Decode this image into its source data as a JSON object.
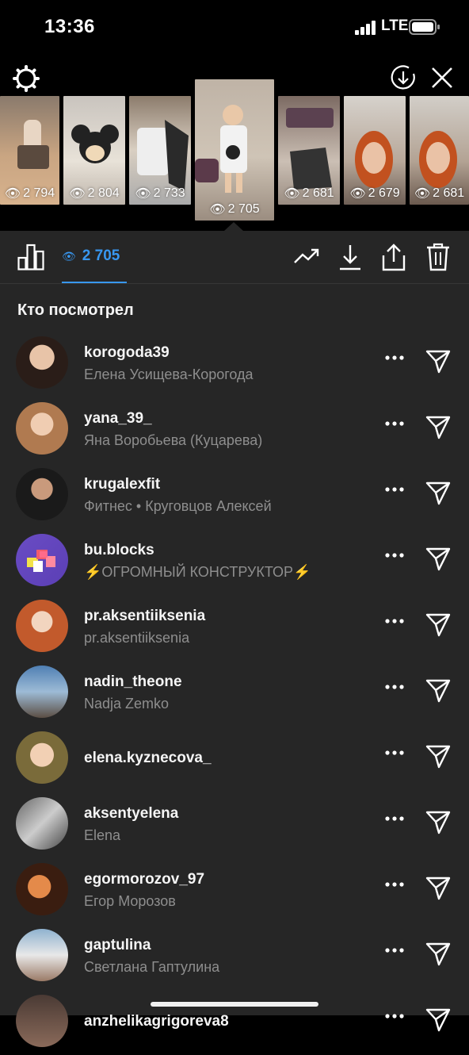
{
  "status": {
    "time": "13:36",
    "network": "LTE"
  },
  "thumbnails": [
    {
      "count": "2 794"
    },
    {
      "count": "2 804"
    },
    {
      "count": "2 733"
    },
    {
      "count": "2 705",
      "selected": true
    },
    {
      "count": "2 681"
    },
    {
      "count": "2 679"
    },
    {
      "count": "2 681"
    }
  ],
  "toolbar": {
    "views_count": "2 705"
  },
  "section_title": "Кто посмотрел",
  "viewers": [
    {
      "username": "korogoda39",
      "name": "Елена Усищева-Корогода"
    },
    {
      "username": "yana_39_",
      "name": "Яна Воробьева (Куцарева)"
    },
    {
      "username": "krugalexfit",
      "name": "Фитнес • Круговцов Алексей"
    },
    {
      "username": "bu.blocks",
      "name": "⚡ОГРОМНЫЙ КОНСТРУКТОР⚡"
    },
    {
      "username": "pr.aksentiiksenia",
      "name": "pr.aksentiiksenia"
    },
    {
      "username": "nadin_theone",
      "name": "Nadja Zemko"
    },
    {
      "username": "elena.kyznecova_",
      "name": ""
    },
    {
      "username": "aksentyelena",
      "name": "Elena"
    },
    {
      "username": "egormorozov_97",
      "name": "Егор Морозов"
    },
    {
      "username": "gaptulina",
      "name": "Светлана Гаптулина"
    },
    {
      "username": "anzhelikagrigoreva8",
      "name": ""
    }
  ],
  "colors": {
    "accent": "#3897f0",
    "panel": "#262626",
    "secondary_text": "#8e8e8e"
  }
}
